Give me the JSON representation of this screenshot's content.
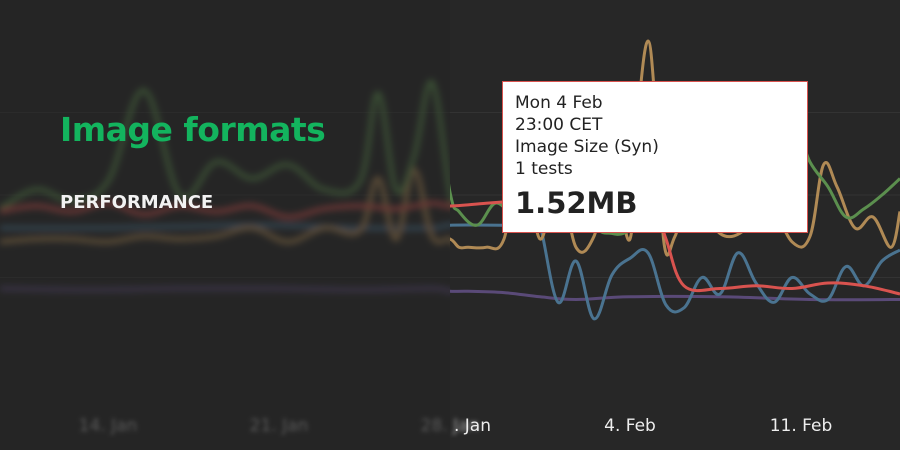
{
  "hero": {
    "title": "Image formats",
    "subtitle": "PERFORMANCE"
  },
  "tooltip": {
    "date": "Mon 4 Feb",
    "time": "23:00 CET",
    "metric": "Image Size (Syn)",
    "tests": "1 tests",
    "value": "1.52MB"
  },
  "colors": {
    "background": "#272727",
    "title": "#13b45e",
    "red": "#d9534f",
    "green": "#5b8f4e",
    "orange": "#b08a55",
    "blue": "#4a7390",
    "purple": "#5a4a78"
  },
  "chart_data": {
    "type": "line",
    "ylim": [
      0,
      12
    ],
    "xlim": [
      0,
      100
    ],
    "xticks": [
      {
        "label": "14. Jan",
        "x": 12,
        "blurred": true
      },
      {
        "label": "21. Jan",
        "x": 31,
        "blurred": true
      },
      {
        "label": "28. Jan",
        "x": 50,
        "blurred": true
      },
      {
        "label": ". Jan",
        "x": 52.5,
        "blurred": false
      },
      {
        "label": "4. Feb",
        "x": 70,
        "blurred": false
      },
      {
        "label": "11. Feb",
        "x": 89,
        "blurred": false
      }
    ],
    "highlight": {
      "series": 0,
      "x": 72.7,
      "y": 5.5
    },
    "series": [
      {
        "color": "#d9534f",
        "blurred_until": 50,
        "x": [
          0,
          4,
          8,
          12,
          16,
          20,
          24,
          28,
          32,
          36,
          40,
          44,
          48,
          50,
          54,
          58,
          62,
          66,
          70,
          72.7,
          74,
          76,
          80,
          84,
          88,
          92,
          96,
          100
        ],
        "y": [
          5.4,
          5.6,
          5.4,
          5.7,
          5.3,
          5.6,
          5.4,
          5.6,
          5.2,
          5.5,
          5.6,
          5.5,
          5.7,
          5.6,
          5.7,
          5.8,
          5.9,
          5.6,
          5.5,
          5.5,
          4.4,
          2.7,
          2.6,
          2.7,
          2.6,
          2.8,
          2.7,
          2.4
        ]
      },
      {
        "color": "#5b8f4e",
        "blurred_until": 50,
        "x": [
          0,
          4,
          8,
          12,
          16,
          20,
          24,
          28,
          32,
          36,
          40,
          42,
          44,
          46,
          48,
          50,
          51,
          53,
          55,
          57,
          58,
          60,
          62,
          64,
          66,
          68,
          70,
          72,
          74,
          76,
          78,
          80,
          82,
          84,
          86,
          88,
          90,
          92,
          94,
          96,
          98,
          100
        ],
        "y": [
          5.5,
          6.2,
          5.8,
          6.5,
          9.8,
          6,
          7.2,
          6.6,
          7.1,
          6.2,
          6.5,
          9.7,
          6.2,
          7.4,
          10.1,
          6.1,
          5.4,
          4.9,
          5.7,
          5.4,
          6.4,
          9.3,
          6.8,
          8.3,
          5.1,
          4.6,
          4.7,
          5.2,
          5.1,
          5.6,
          5.6,
          5.6,
          4.7,
          5.4,
          7.3,
          8.7,
          7.2,
          6.3,
          5.2,
          5.5,
          6.0,
          6.6
        ]
      },
      {
        "color": "#b08a55",
        "blurred_until": 50,
        "x": [
          0,
          4,
          8,
          12,
          16,
          20,
          24,
          28,
          32,
          36,
          40,
          42,
          44,
          46,
          48,
          50,
          51,
          52,
          54,
          56,
          58,
          60,
          62,
          64,
          66,
          68,
          70,
          71,
          72,
          72.8,
          73.8,
          75,
          77,
          80,
          83,
          85,
          88,
          90,
          91.5,
          93,
          95,
          97,
          99,
          100
        ],
        "y": [
          4.3,
          4.4,
          4.4,
          4.3,
          4.5,
          4.4,
          4.5,
          4.8,
          4.3,
          4.8,
          4.7,
          6.6,
          4.4,
          6.9,
          4.5,
          4.4,
          4.1,
          4.1,
          4.1,
          4.4,
          7.5,
          4.4,
          6.7,
          4.1,
          4.5,
          6.9,
          4.4,
          9.3,
          11.6,
          9.3,
          4.2,
          4.5,
          6.2,
          4.6,
          4.8,
          6,
          4.3,
          4.5,
          7.1,
          6.3,
          4.8,
          5.2,
          4.1,
          5.4
        ]
      },
      {
        "color": "#4a7390",
        "blurred_until": 50,
        "x": [
          0,
          10,
          20,
          30,
          40,
          48,
          50,
          56,
          59,
          60,
          62,
          64,
          66,
          68,
          70,
          72,
          74,
          76,
          78,
          80,
          82,
          84,
          86,
          88,
          90,
          92,
          94,
          96,
          98,
          100
        ],
        "y": [
          4.8,
          4.8,
          4.85,
          4.9,
          4.8,
          4.8,
          4.9,
          4.9,
          4.9,
          4.9,
          2.1,
          3.6,
          1.5,
          3.1,
          3.7,
          3.9,
          2.0,
          1.9,
          3.0,
          2.4,
          3.9,
          2.8,
          2.1,
          3.0,
          2.4,
          2.2,
          3.4,
          2.7,
          3.6,
          4.0
        ]
      },
      {
        "color": "#5a4a78",
        "blurred_until": 50,
        "x": [
          0,
          10,
          20,
          30,
          40,
          48,
          50,
          52,
          56,
          60,
          64,
          70,
          80,
          90,
          100
        ],
        "y": [
          2.6,
          2.55,
          2.6,
          2.6,
          2.55,
          2.6,
          2.5,
          2.5,
          2.45,
          2.3,
          2.2,
          2.3,
          2.3,
          2.2,
          2.2
        ]
      }
    ]
  }
}
